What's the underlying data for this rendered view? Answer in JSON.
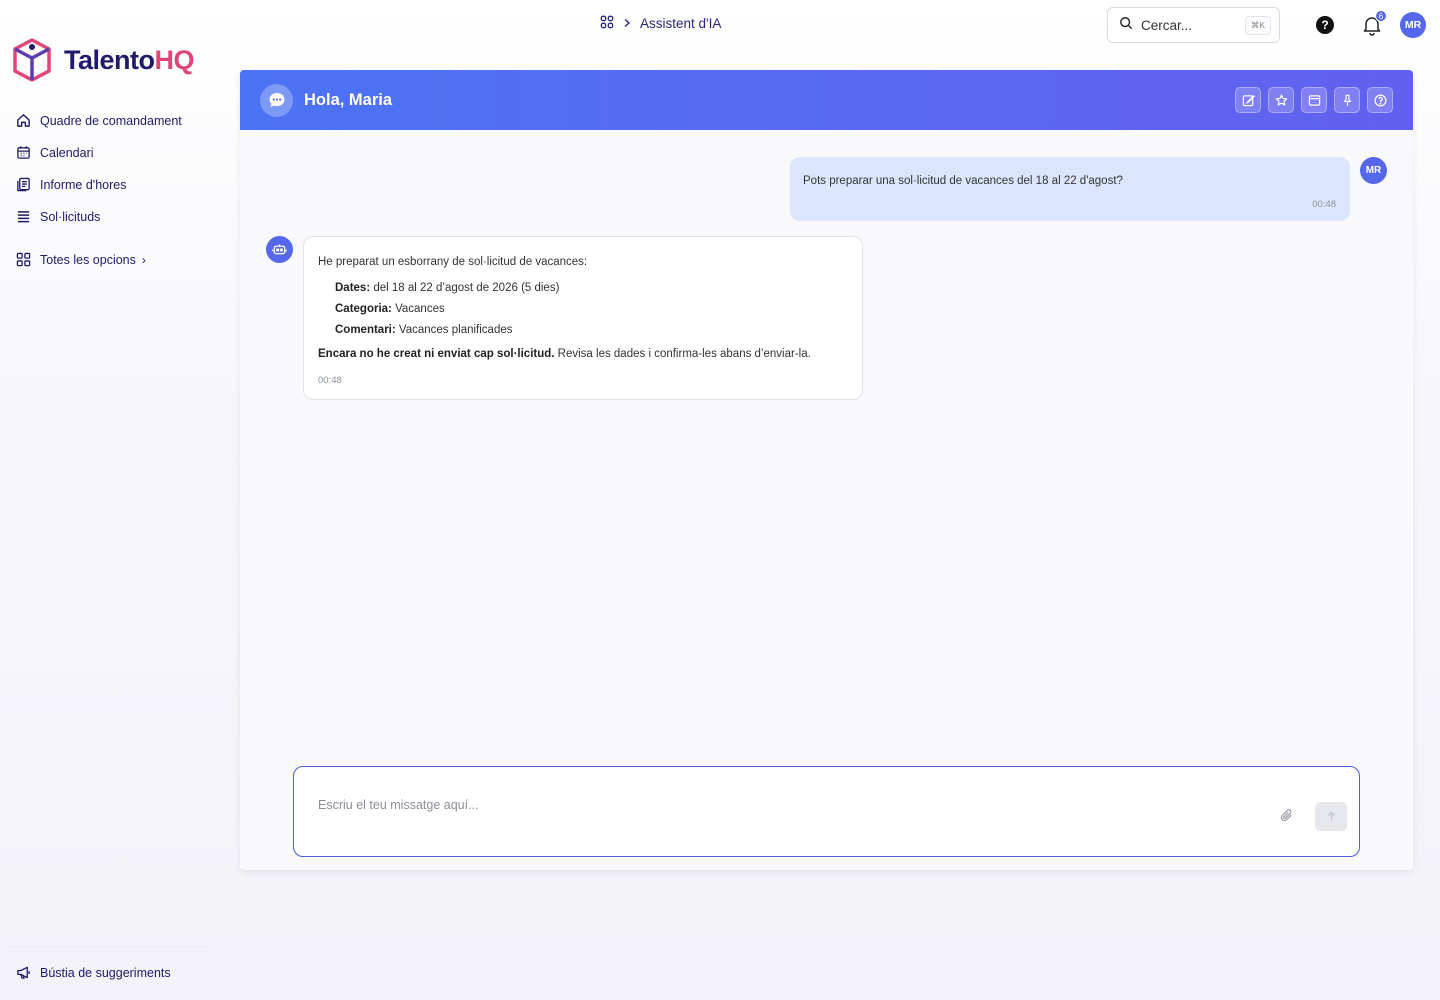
{
  "brand": {
    "name_part1": "Talento",
    "name_part2": "HQ"
  },
  "sidebar": {
    "items": [
      {
        "label": "Quadre de comandament",
        "icon": "home-icon"
      },
      {
        "label": "Calendari",
        "icon": "calendar-icon"
      },
      {
        "label": "Informe d'hores",
        "icon": "report-icon"
      },
      {
        "label": "Sol·licituds",
        "icon": "list-icon"
      }
    ],
    "all_options": "Totes les opcions",
    "feedback": "Bústia de suggeriments"
  },
  "topbar": {
    "breadcrumb_current": "Assistent d'IA",
    "search_placeholder": "Cercar...",
    "search_shortcut": "⌘K",
    "help": "?",
    "notifications_count": "6",
    "user_initials": "MR"
  },
  "chat": {
    "greeting": "Hola, Maria",
    "user_message": {
      "text": "Pots preparar una sol·licitud de vacances del 18 al 22 d'agost?",
      "time": "00:48",
      "initials": "MR"
    },
    "bot_message": {
      "intro": "He preparat un esborrany de sol·licitud de vacances:",
      "fields": [
        {
          "label": "Dates:",
          "value": "del 18 al 22 d’agost de 2026 (5 dies)"
        },
        {
          "label": "Categoria:",
          "value": "Vacances"
        },
        {
          "label": "Comentari:",
          "value": "Vacances planificades"
        }
      ],
      "warning_bold": "Encara no he creat ni enviat cap sol·licitud.",
      "warning_rest": "Revisa les dades i confirma-les abans d’enviar-la.",
      "time": "00:48"
    },
    "composer_placeholder": "Escriu el teu missatge aquí..."
  },
  "colors": {
    "accent": "#5567ec",
    "brand_dark": "#1f1a6b",
    "brand_pink": "#e0457a",
    "user_bubble": "#dbe6fd"
  }
}
